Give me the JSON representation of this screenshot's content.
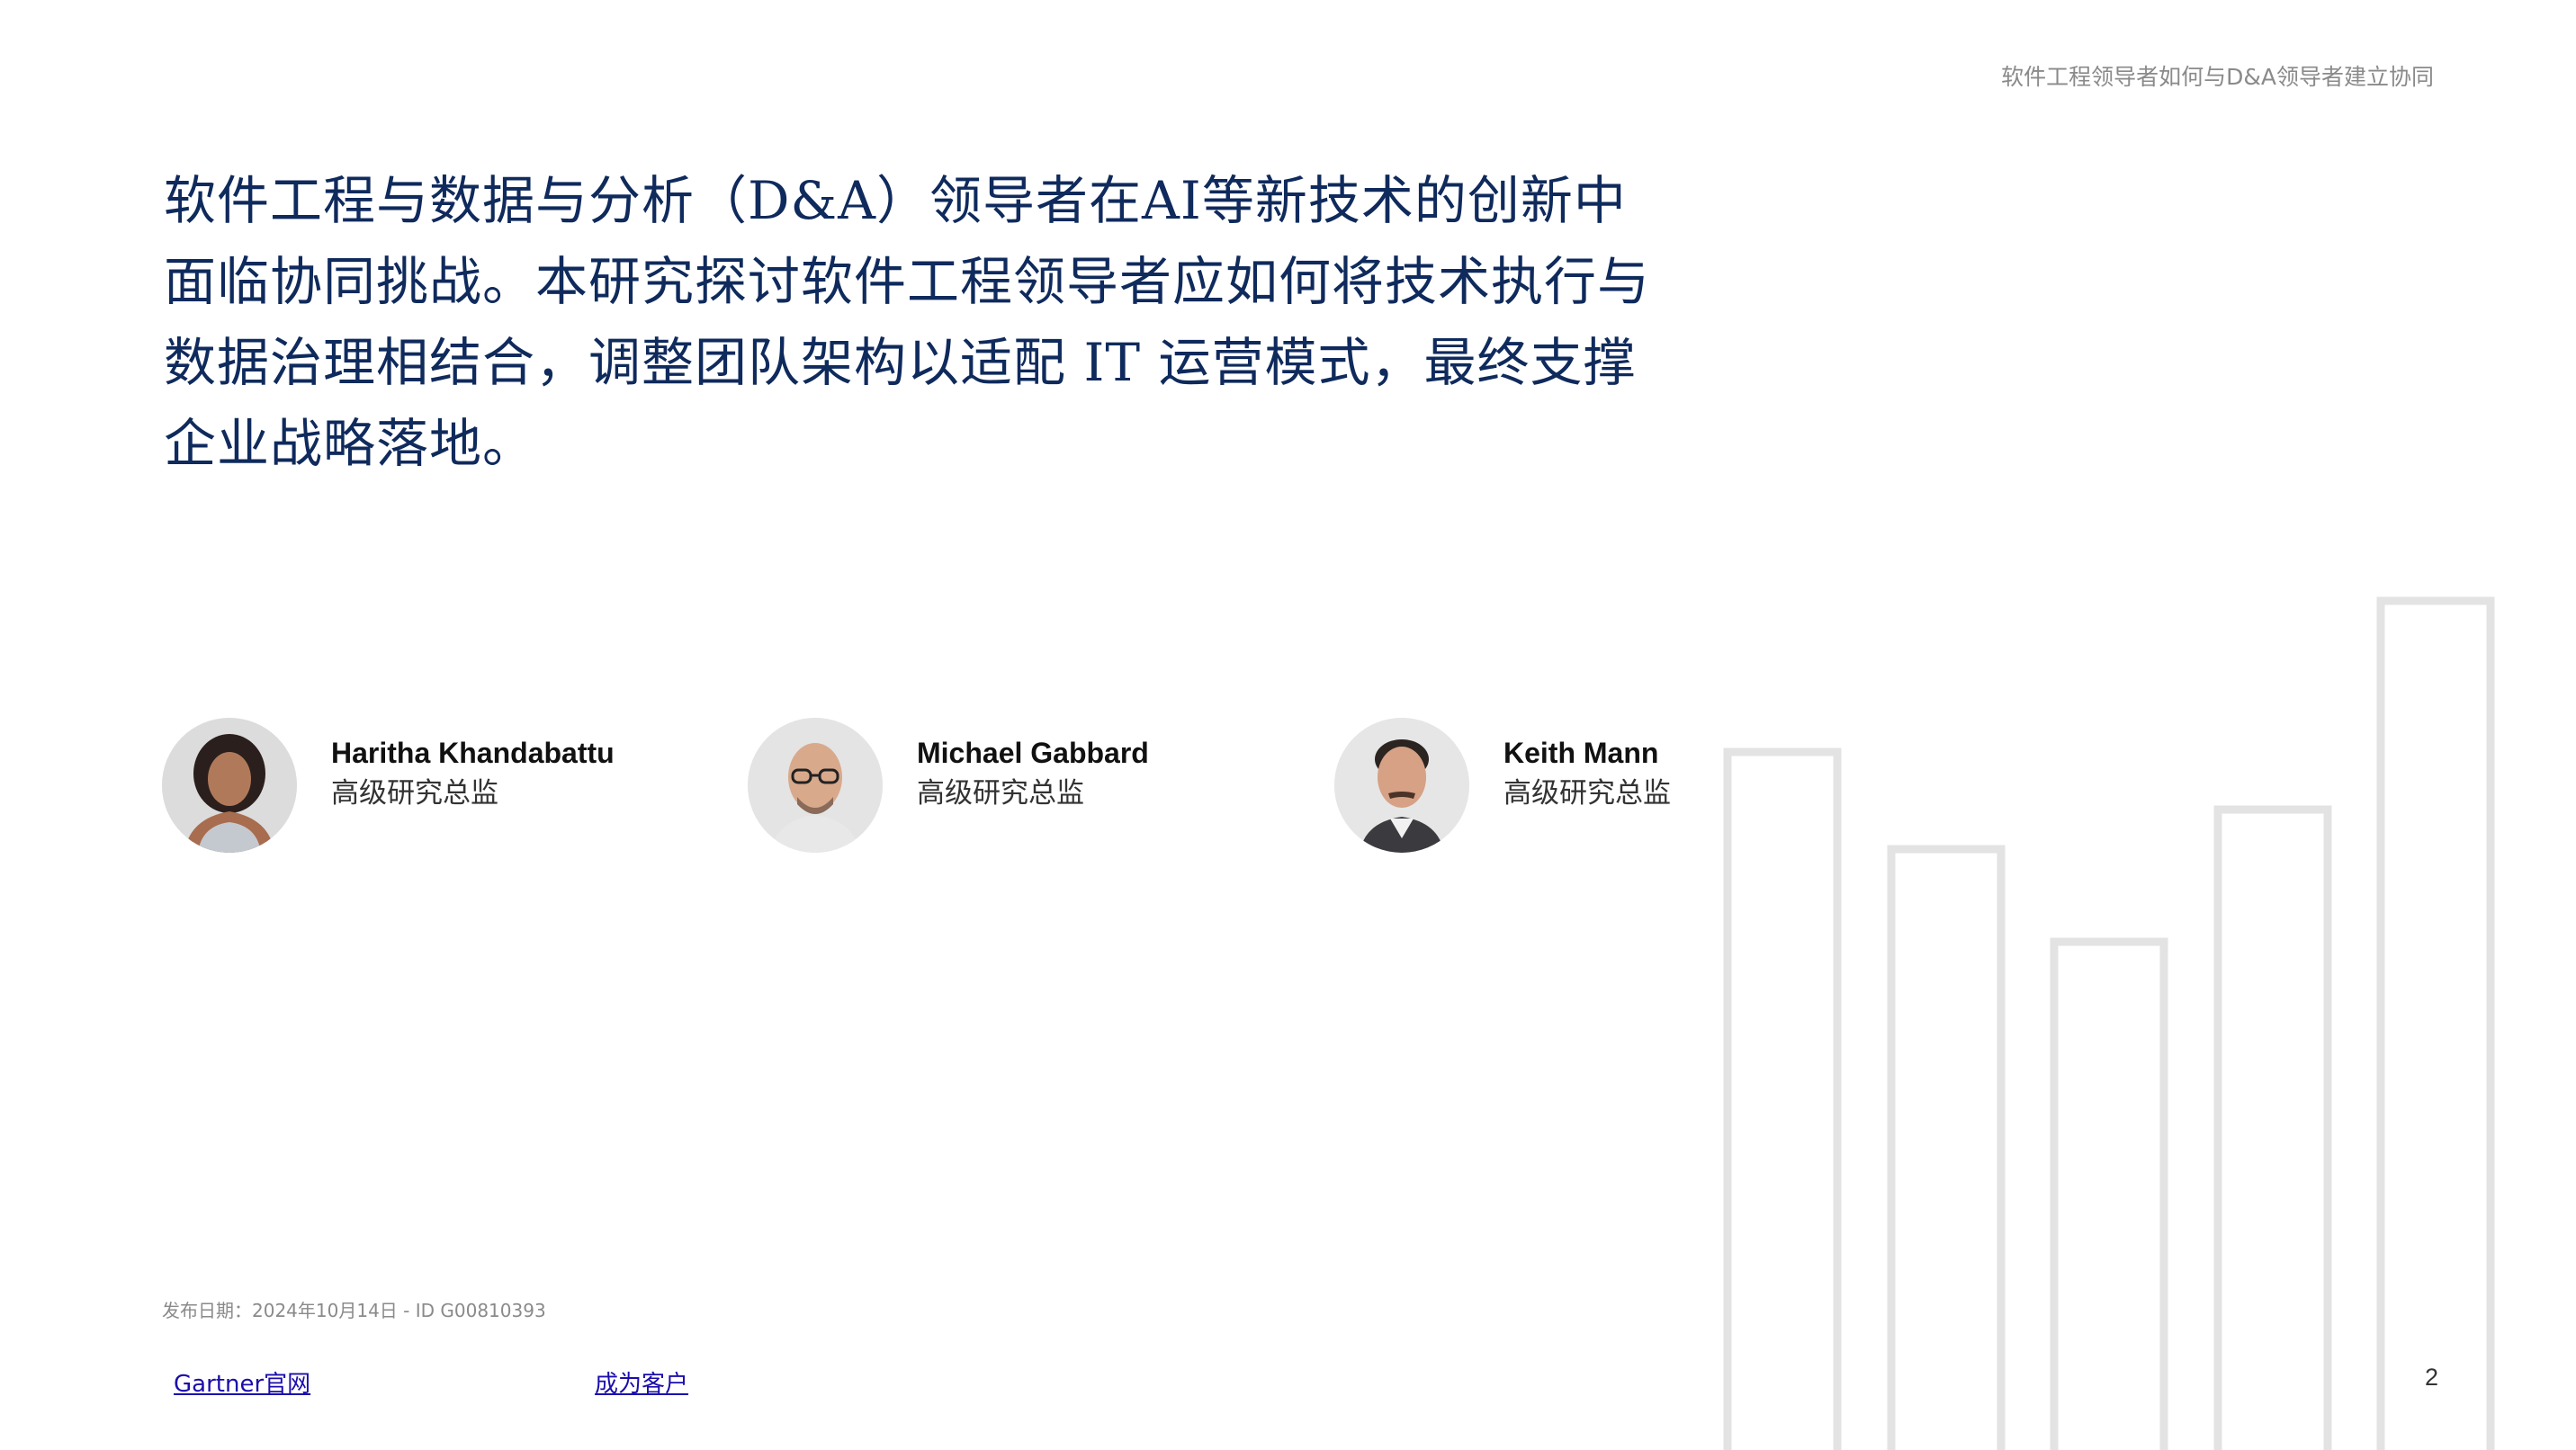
{
  "header": {
    "title": "软件工程领导者如何与D&A领导者建立协同"
  },
  "intro": {
    "text": "软件工程与数据与分析（D&A）领导者在AI等新技术的创新中面临协同挑战。本研究探讨软件工程领导者应如何将技术执行与数据治理相结合，调整团队架构以适配 IT 运营模式，最终支撑企业战略落地。"
  },
  "authors": [
    {
      "name": "Haritha Khandabattu",
      "role": "高级研究总监"
    },
    {
      "name": "Michael Gabbard",
      "role": "高级研究总监"
    },
    {
      "name": "Keith Mann",
      "role": "高级研究总监"
    }
  ],
  "footer": {
    "publication": "发布日期：2024年10月14日 - ID G00810393",
    "links": {
      "gartner": "Gartner官网",
      "become_client": "成为客户"
    },
    "page_number": "2"
  },
  "colors": {
    "heading_text": "#0f2a5c",
    "link": "#1a0dab",
    "decor_bars": "#e3e3e3",
    "muted_text": "#8a8a8a"
  },
  "icons": {
    "decoration": "bar-chart-outline-icon",
    "avatars": [
      "person-photo-icon",
      "person-photo-icon",
      "person-photo-icon"
    ]
  }
}
